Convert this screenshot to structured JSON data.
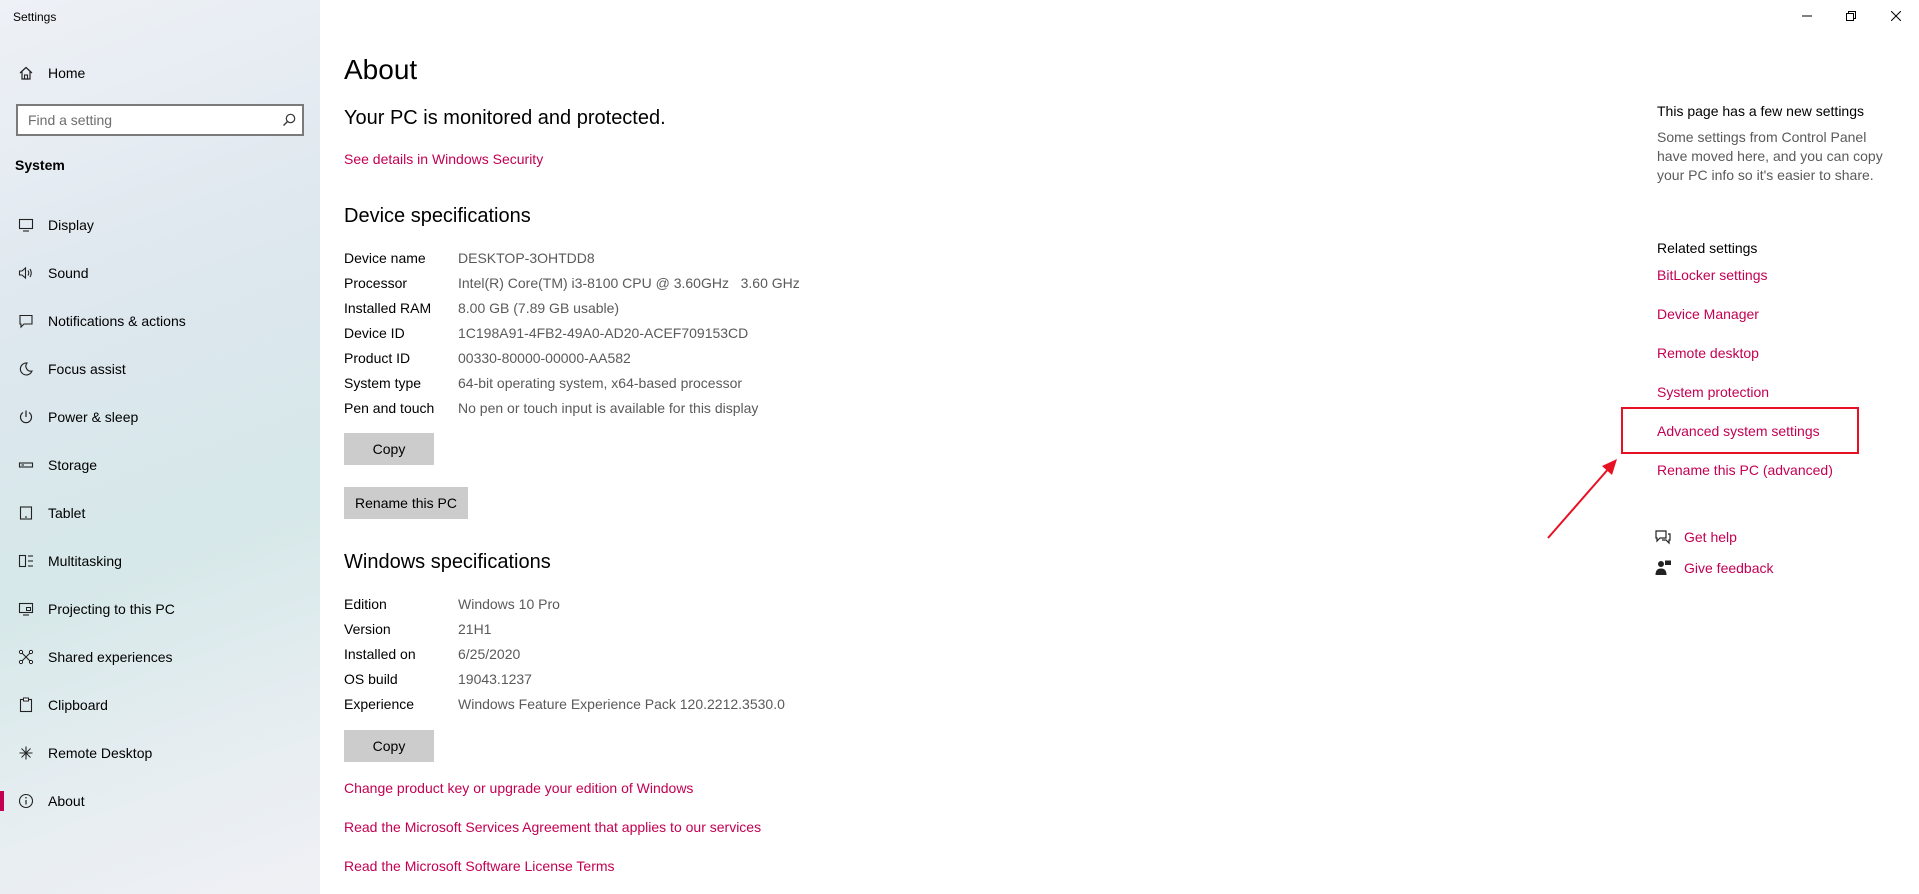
{
  "window": {
    "title": "Settings",
    "controls": {
      "minimize": "minimize-icon",
      "restore": "restore-icon",
      "close": "close-icon"
    }
  },
  "sidebar": {
    "home": {
      "label": "Home",
      "icon": "home-icon"
    },
    "search": {
      "placeholder": "Find a setting",
      "value": ""
    },
    "section": "System",
    "items": [
      {
        "label": "Display",
        "icon": "display-icon"
      },
      {
        "label": "Sound",
        "icon": "sound-icon"
      },
      {
        "label": "Notifications & actions",
        "icon": "notifications-icon"
      },
      {
        "label": "Focus assist",
        "icon": "focus-assist-icon"
      },
      {
        "label": "Power & sleep",
        "icon": "power-icon"
      },
      {
        "label": "Storage",
        "icon": "storage-icon"
      },
      {
        "label": "Tablet",
        "icon": "tablet-icon"
      },
      {
        "label": "Multitasking",
        "icon": "multitasking-icon"
      },
      {
        "label": "Projecting to this PC",
        "icon": "projecting-icon"
      },
      {
        "label": "Shared experiences",
        "icon": "shared-experiences-icon"
      },
      {
        "label": "Clipboard",
        "icon": "clipboard-icon"
      },
      {
        "label": "Remote Desktop",
        "icon": "remote-desktop-icon"
      },
      {
        "label": "About",
        "icon": "about-icon",
        "active": true
      }
    ]
  },
  "main": {
    "title": "About",
    "protection_status": "Your PC is monitored and protected.",
    "security_link": "See details in Windows Security",
    "device_specs": {
      "heading": "Device specifications",
      "rows": [
        {
          "key": "Device name",
          "value": "DESKTOP-3OHTDD8"
        },
        {
          "key": "Processor",
          "value": "Intel(R) Core(TM) i3-8100 CPU @ 3.60GHz   3.60 GHz"
        },
        {
          "key": "Installed RAM",
          "value": "8.00 GB (7.89 GB usable)"
        },
        {
          "key": "Device ID",
          "value": "1C198A91-4FB2-49A0-AD20-ACEF709153CD"
        },
        {
          "key": "Product ID",
          "value": "00330-80000-00000-AA582"
        },
        {
          "key": "System type",
          "value": "64-bit operating system, x64-based processor"
        },
        {
          "key": "Pen and touch",
          "value": "No pen or touch input is available for this display"
        }
      ],
      "copy_label": "Copy",
      "rename_label": "Rename this PC"
    },
    "windows_specs": {
      "heading": "Windows specifications",
      "rows": [
        {
          "key": "Edition",
          "value": "Windows 10 Pro"
        },
        {
          "key": "Version",
          "value": "21H1"
        },
        {
          "key": "Installed on",
          "value": "6/25/2020"
        },
        {
          "key": "OS build",
          "value": "19043.1237"
        },
        {
          "key": "Experience",
          "value": "Windows Feature Experience Pack 120.2212.3530.0"
        }
      ],
      "copy_label": "Copy"
    },
    "links": [
      "Change product key or upgrade your edition of Windows",
      "Read the Microsoft Services Agreement that applies to our services",
      "Read the Microsoft Software License Terms"
    ]
  },
  "right_pane": {
    "new_settings_title": "This page has a few new settings",
    "new_settings_text": "Some settings from Control Panel have moved here, and you can copy your PC info so it's easier to share.",
    "related_title": "Related settings",
    "related_links": [
      "BitLocker settings",
      "Device Manager",
      "Remote desktop",
      "System protection",
      "Advanced system settings",
      "Rename this PC (advanced)"
    ],
    "get_help": {
      "label": "Get help",
      "icon": "get-help-icon"
    },
    "give_feedback": {
      "label": "Give feedback",
      "icon": "feedback-icon"
    }
  },
  "colors": {
    "accent": "#c30052",
    "annotation": "#e81123",
    "button_bg": "#cccccc",
    "secondary_text": "#5a5a5a"
  }
}
